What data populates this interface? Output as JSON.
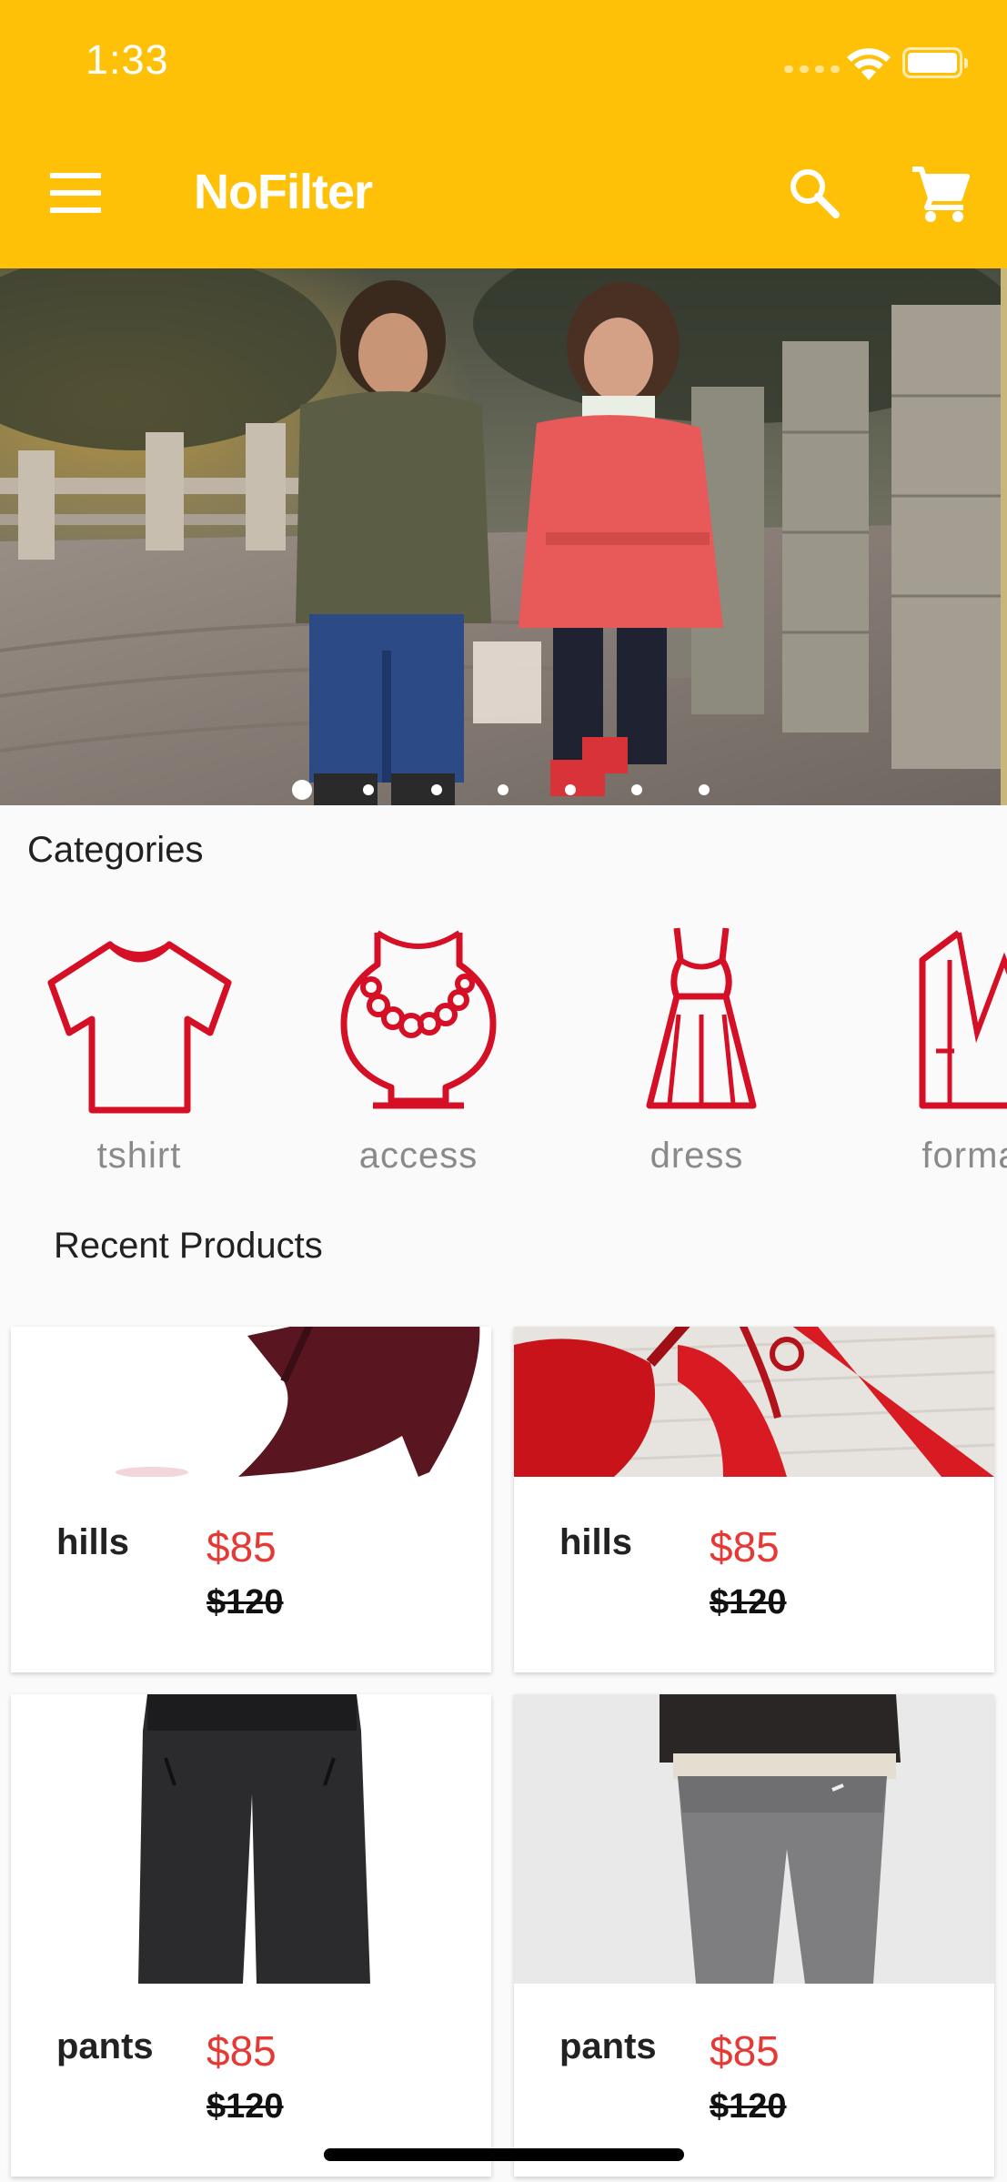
{
  "status_bar": {
    "time": "1:33"
  },
  "app_bar": {
    "title": "NoFilter",
    "icons": [
      "menu-icon",
      "search-icon",
      "cart-icon"
    ]
  },
  "carousel": {
    "slide_count": 7,
    "active_index": 0,
    "image": "two children standing on a stone walkway"
  },
  "categories": {
    "title": "Categories",
    "items": [
      {
        "label": "tshirt",
        "icon": "tshirt-icon"
      },
      {
        "label": "access",
        "icon": "necklace-icon"
      },
      {
        "label": "dress",
        "icon": "dress-icon"
      },
      {
        "label": "formal",
        "icon": "blazer-icon"
      }
    ],
    "icon_color": "#D50F25"
  },
  "recent_products": {
    "title": "Recent Products",
    "items": [
      {
        "name": "hills",
        "price": "$85",
        "old_price": "$120",
        "image": "burgundy high heel"
      },
      {
        "name": "hills",
        "price": "$85",
        "old_price": "$120",
        "image": "red high heels"
      },
      {
        "name": "pants",
        "price": "$85",
        "old_price": "$120",
        "image": "black pants"
      },
      {
        "name": "pants",
        "price": "$85",
        "old_price": "$120",
        "image": "grey sweatpants"
      }
    ]
  },
  "colors": {
    "primary": "#FFC107",
    "price": "#E53935",
    "accent": "#D50F25"
  }
}
